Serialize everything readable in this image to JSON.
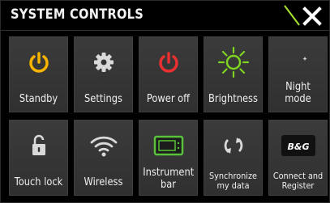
{
  "header": {
    "title": "SYSTEM CONTROLS"
  },
  "tiles": [
    {
      "label": "Standby",
      "icon": "power-icon",
      "icon_color": "#f4b400"
    },
    {
      "label": "Settings",
      "icon": "gear-icon",
      "icon_color": "#d9d9d9"
    },
    {
      "label": "Power off",
      "icon": "power-icon",
      "icon_color": "#e83030"
    },
    {
      "label": "Brightness",
      "icon": "sun-icon",
      "icon_color": "#7ed321"
    },
    {
      "label": "Night mode",
      "icon": "moon-icon",
      "icon_color": "#cfcfcf"
    },
    {
      "label": "Touch lock",
      "icon": "padlock-icon",
      "icon_color": "#d9d9d9"
    },
    {
      "label": "Wireless",
      "icon": "wifi-icon",
      "icon_color": "#d9d9d9"
    },
    {
      "label": "Instrument bar",
      "line1": "Instrument",
      "line2": "bar",
      "icon": "instrument-bar-icon",
      "icon_color": "#59c23a"
    },
    {
      "label": "Synchronize my data",
      "line1": "Synchronize",
      "line2": "my data",
      "icon": "sync-icon",
      "icon_color": "#d9d9d9"
    },
    {
      "label": "Connect and Register",
      "line1": "Connect and",
      "line2": "Register",
      "icon": "bg-logo",
      "logo_text": "B&G"
    }
  ],
  "colors": {
    "accent_green": "#7ed321",
    "tile_bg": "#353535",
    "text": "#f0f0f0"
  }
}
